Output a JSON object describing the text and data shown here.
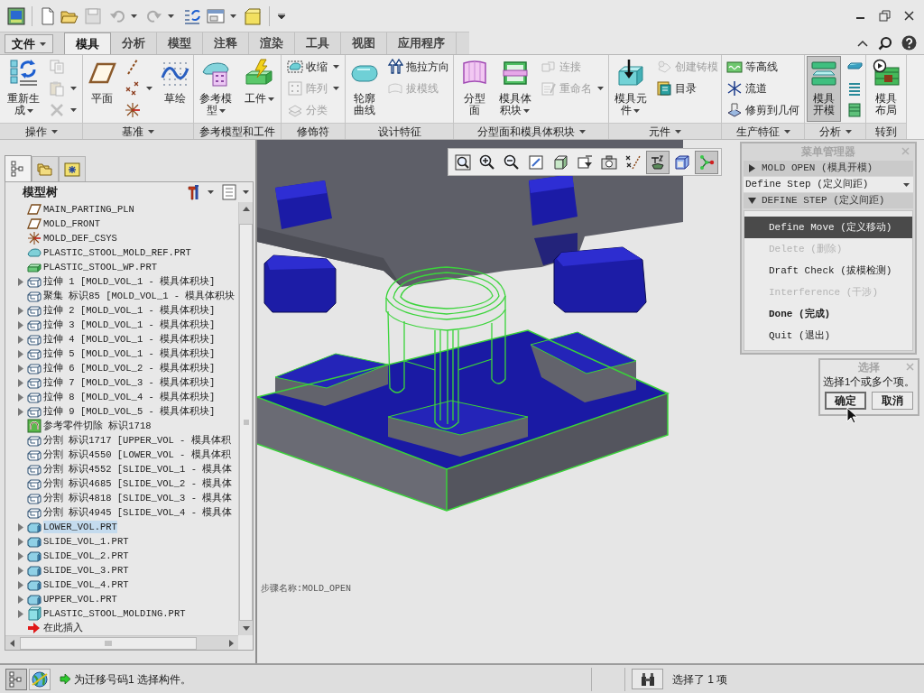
{
  "tabs": [
    {
      "label": "文件",
      "kind": "menu",
      "selected": false
    },
    {
      "label": "模具",
      "kind": "tab",
      "selected": true
    },
    {
      "label": "分析",
      "kind": "tab",
      "selected": false
    },
    {
      "label": "模型",
      "kind": "tab",
      "selected": false
    },
    {
      "label": "注释",
      "kind": "tab",
      "selected": false
    },
    {
      "label": "渲染",
      "kind": "tab",
      "selected": false
    },
    {
      "label": "工具",
      "kind": "tab",
      "selected": false
    },
    {
      "label": "视图",
      "kind": "tab",
      "selected": false
    },
    {
      "label": "应用程序",
      "kind": "tab",
      "selected": false
    }
  ],
  "ribbon": {
    "groups": [
      {
        "label": "操作",
        "dropdown": true,
        "items": [
          {
            "kind": "large",
            "label": "重新生成",
            "dropdown": true,
            "disabled": false,
            "selected": false
          },
          {
            "kind": "small",
            "dropdown": false,
            "disabled": true,
            "selected": false
          },
          {
            "kind": "small",
            "dropdown": true,
            "disabled": true,
            "selected": false
          },
          {
            "kind": "small",
            "dropdown": true,
            "disabled": true,
            "selected": false
          }
        ]
      },
      {
        "label": "基准",
        "dropdown": true,
        "items": [
          {
            "kind": "large",
            "label": "平面",
            "dropdown": false,
            "disabled": false,
            "selected": false
          },
          {
            "kind": "small",
            "dropdown": false,
            "disabled": false,
            "selected": false
          },
          {
            "kind": "small",
            "dropdown": true,
            "disabled": false,
            "selected": false
          },
          {
            "kind": "small",
            "dropdown": false,
            "disabled": false,
            "selected": false
          },
          {
            "kind": "large",
            "label": "草绘",
            "dropdown": false,
            "disabled": false,
            "selected": false
          }
        ]
      },
      {
        "label": "参考模型和工件",
        "dropdown": false,
        "items": [
          {
            "kind": "large",
            "label": "参考模型",
            "dropdown": true,
            "disabled": false,
            "selected": false
          },
          {
            "kind": "large",
            "label": "工件",
            "dropdown": true,
            "disabled": false,
            "selected": false
          }
        ]
      },
      {
        "label": "修饰符",
        "dropdown": false,
        "items": [
          {
            "kind": "small",
            "label": "收缩",
            "dropdown": true,
            "disabled": false,
            "selected": false
          },
          {
            "kind": "small",
            "label": "阵列",
            "dropdown": true,
            "disabled": true,
            "selected": false
          },
          {
            "kind": "small",
            "label": "分类",
            "dropdown": false,
            "disabled": true,
            "selected": false
          }
        ]
      },
      {
        "label": "设计特征",
        "dropdown": false,
        "items": [
          {
            "kind": "large",
            "label": "轮廓曲线",
            "dropdown": false,
            "disabled": false,
            "selected": false
          },
          {
            "kind": "small",
            "label": "拖拉方向",
            "dropdown": false,
            "disabled": false,
            "selected": false
          },
          {
            "kind": "small",
            "label": "拔模线",
            "dropdown": false,
            "disabled": true,
            "selected": false
          }
        ]
      },
      {
        "label": "分型面和模具体积块",
        "dropdown": true,
        "items": [
          {
            "kind": "large",
            "label": "分型面",
            "dropdown": false,
            "disabled": false,
            "selected": false
          },
          {
            "kind": "large",
            "label": "模具体积块",
            "dropdown": true,
            "disabled": false,
            "selected": false
          },
          {
            "kind": "small",
            "label": "连接",
            "dropdown": false,
            "disabled": true,
            "selected": false
          },
          {
            "kind": "small",
            "label": "重命名",
            "dropdown": true,
            "disabled": true,
            "selected": false
          }
        ]
      },
      {
        "label": "元件",
        "dropdown": true,
        "items": [
          {
            "kind": "large",
            "label": "模具元件",
            "dropdown": true,
            "disabled": false,
            "selected": false
          },
          {
            "kind": "small",
            "label": "创建铸模",
            "dropdown": false,
            "disabled": true,
            "selected": false
          },
          {
            "kind": "small",
            "label": "目录",
            "dropdown": false,
            "disabled": false,
            "selected": false
          }
        ]
      },
      {
        "label": "生产特征",
        "dropdown": true,
        "items": [
          {
            "kind": "small",
            "label": "等高线",
            "dropdown": false,
            "disabled": false,
            "selected": false
          },
          {
            "kind": "small",
            "label": "流道",
            "dropdown": false,
            "disabled": false,
            "selected": false
          },
          {
            "kind": "small",
            "label": "修剪到几何",
            "dropdown": false,
            "disabled": false,
            "selected": false
          }
        ]
      },
      {
        "label": "分析",
        "dropdown": true,
        "items": [
          {
            "kind": "large",
            "label": "模具开模",
            "dropdown": false,
            "disabled": false,
            "selected": true
          },
          {
            "kind": "small",
            "dropdown": false,
            "disabled": false,
            "selected": false
          },
          {
            "kind": "small",
            "dropdown": false,
            "disabled": false,
            "selected": false
          },
          {
            "kind": "small",
            "dropdown": false,
            "disabled": false,
            "selected": false
          }
        ]
      },
      {
        "label": "转到",
        "dropdown": false,
        "items": [
          {
            "kind": "large",
            "label": "模具布局",
            "dropdown": false,
            "disabled": false,
            "selected": false
          }
        ]
      }
    ]
  },
  "navigator_tabs": [
    {
      "selected": true
    },
    {
      "selected": false
    },
    {
      "selected": false
    }
  ],
  "model_tree": {
    "title": "模型树",
    "rows": [
      {
        "label": "MAIN_PARTING_PLN",
        "kind": "datum_plane",
        "expandable": false,
        "selected": false
      },
      {
        "label": "MOLD_FRONT",
        "kind": "datum_plane",
        "expandable": false,
        "selected": false
      },
      {
        "label": "MOLD_DEF_CSYS",
        "kind": "csys",
        "expandable": false,
        "selected": false
      },
      {
        "label": "PLASTIC_STOOL_MOLD_REF.PRT",
        "kind": "ref_model",
        "expandable": false,
        "selected": false
      },
      {
        "label": "PLASTIC_STOOL_WP.PRT",
        "kind": "workpiece",
        "expandable": false,
        "selected": false
      },
      {
        "label": "拉伸 1 [MOLD_VOL_1 - 模具体积块]",
        "kind": "feature",
        "expandable": true,
        "selected": false
      },
      {
        "label": "聚集 标识85 [MOLD_VOL_1 - 模具体积块",
        "kind": "feature",
        "expandable": false,
        "selected": false
      },
      {
        "label": "拉伸 2 [MOLD_VOL_1 - 模具体积块]",
        "kind": "feature",
        "expandable": true,
        "selected": false
      },
      {
        "label": "拉伸 3 [MOLD_VOL_1 - 模具体积块]",
        "kind": "feature",
        "expandable": true,
        "selected": false
      },
      {
        "label": "拉伸 4 [MOLD_VOL_1 - 模具体积块]",
        "kind": "feature",
        "expandable": true,
        "selected": false
      },
      {
        "label": "拉伸 5 [MOLD_VOL_1 - 模具体积块]",
        "kind": "feature",
        "expandable": true,
        "selected": false
      },
      {
        "label": "拉伸 6 [MOLD_VOL_2 - 模具体积块]",
        "kind": "feature",
        "expandable": true,
        "selected": false
      },
      {
        "label": "拉伸 7 [MOLD_VOL_3 - 模具体积块]",
        "kind": "feature",
        "expandable": true,
        "selected": false
      },
      {
        "label": "拉伸 8 [MOLD_VOL_4 - 模具体积块]",
        "kind": "feature",
        "expandable": true,
        "selected": false
      },
      {
        "label": "拉伸 9 [MOLD_VOL_5 - 模具体积块]",
        "kind": "feature",
        "expandable": true,
        "selected": false
      },
      {
        "label": "参考零件切除 标识1718",
        "kind": "cut",
        "expandable": false,
        "selected": false
      },
      {
        "label": "分割 标识1717 [UPPER_VOL - 模具体积",
        "kind": "feature",
        "expandable": false,
        "selected": false
      },
      {
        "label": "分割 标识4550 [LOWER_VOL - 模具体积",
        "kind": "feature",
        "expandable": false,
        "selected": false
      },
      {
        "label": "分割 标识4552 [SLIDE_VOL_1 - 模具体",
        "kind": "feature",
        "expandable": false,
        "selected": false
      },
      {
        "label": "分割 标识4685 [SLIDE_VOL_2 - 模具体",
        "kind": "feature",
        "expandable": false,
        "selected": false
      },
      {
        "label": "分割 标识4818 [SLIDE_VOL_3 - 模具体",
        "kind": "feature",
        "expandable": false,
        "selected": false
      },
      {
        "label": "分割 标识4945 [SLIDE_VOL_4 - 模具体",
        "kind": "feature",
        "expandable": false,
        "selected": false
      },
      {
        "label": "LOWER_VOL.PRT",
        "kind": "volume_part",
        "expandable": true,
        "selected": true
      },
      {
        "label": "SLIDE_VOL_1.PRT",
        "kind": "volume_part",
        "expandable": true,
        "selected": false
      },
      {
        "label": "SLIDE_VOL_2.PRT",
        "kind": "volume_part",
        "expandable": true,
        "selected": false
      },
      {
        "label": "SLIDE_VOL_3.PRT",
        "kind": "volume_part",
        "expandable": true,
        "selected": false
      },
      {
        "label": "SLIDE_VOL_4.PRT",
        "kind": "volume_part",
        "expandable": true,
        "selected": false
      },
      {
        "label": "UPPER_VOL.PRT",
        "kind": "volume_part",
        "expandable": true,
        "selected": false
      },
      {
        "label": "PLASTIC_STOOL_MOLDING.PRT",
        "kind": "molding",
        "expandable": true,
        "selected": false
      },
      {
        "label": "在此插入",
        "kind": "insert",
        "expandable": false,
        "selected": false
      }
    ]
  },
  "view_toolbar": [
    {
      "pressed": false
    },
    {
      "pressed": false
    },
    {
      "pressed": false
    },
    {
      "pressed": false
    },
    {
      "pressed": false
    },
    {
      "pressed": false
    },
    {
      "pressed": false
    },
    {
      "pressed": false
    },
    {
      "pressed": true
    },
    {
      "pressed": false
    },
    {
      "pressed": true
    }
  ],
  "step_label": "步骤名称:MOLD_OPEN",
  "menu_manager": {
    "title": "菜单管理器",
    "sections": [
      {
        "kind": "header",
        "label": "MOLD OPEN (模具开模)",
        "expanded": false
      },
      {
        "kind": "dropdown",
        "label": "Define Step (定义间距)"
      },
      {
        "kind": "header",
        "label": "DEFINE STEP (定义间距)",
        "expanded": true
      }
    ],
    "items": [
      {
        "label": "Define Move (定义移动)",
        "selected": true,
        "disabled": false,
        "default": false
      },
      {
        "label": "Delete (删除)",
        "selected": false,
        "disabled": true,
        "default": false
      },
      {
        "label": "Draft Check (拔模检测)",
        "selected": false,
        "disabled": false,
        "default": false
      },
      {
        "label": "Interference (干涉)",
        "selected": false,
        "disabled": true,
        "default": false
      },
      {
        "label": "Done (完成)",
        "selected": false,
        "disabled": false,
        "default": true
      },
      {
        "label": "Quit (退出)",
        "selected": false,
        "disabled": false,
        "default": false
      }
    ]
  },
  "select_dialog": {
    "title": "选择",
    "message": "选择1个或多个项。",
    "buttons": [
      {
        "label": "确定",
        "default": true
      },
      {
        "label": "取消",
        "default": false
      }
    ]
  },
  "status_bar": {
    "toggles": [
      {
        "selected": true
      },
      {
        "selected": false
      }
    ],
    "message": "为迁移号码1 选择构件。",
    "selection_count": "选择了 1 项"
  }
}
